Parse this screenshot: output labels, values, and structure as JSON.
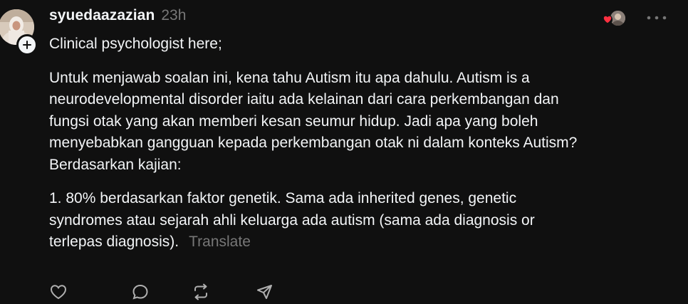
{
  "post": {
    "username": "syuedaazazian",
    "timestamp": "23h",
    "paragraphs": [
      "Clinical psychologist here;",
      "Untuk menjawab soalan ini, kena tahu Autism itu apa dahulu. Autism is a\nneurodevelopmental disorder iaitu ada kelainan dari cara perkembangan dan\nfungsi otak yang akan memberi kesan seumur hidup. Jadi apa yang boleh\nmenyebabkan gangguan kepada perkembangan otak ni dalam konteks Autism?\nBerdasarkan kajian:",
      "1. 80% berdasarkan faktor genetik. Sama ada inherited genes, genetic\nsyndromes atau sejarah ahli keluarga ada autism (sama ada diagnosis or\nterlepas diagnosis)."
    ],
    "translate_label": "Translate"
  },
  "icons": {
    "avatar": "profile-photo",
    "follow": "plus-icon",
    "heart": "heart-icon",
    "more": "ellipsis-icon",
    "actions": [
      "like-icon",
      "reply-icon",
      "repost-icon",
      "share-icon"
    ]
  },
  "colors": {
    "background": "#101010",
    "text_primary": "#f3f5f7",
    "text_secondary": "#777777",
    "heart": "#ff3040"
  }
}
